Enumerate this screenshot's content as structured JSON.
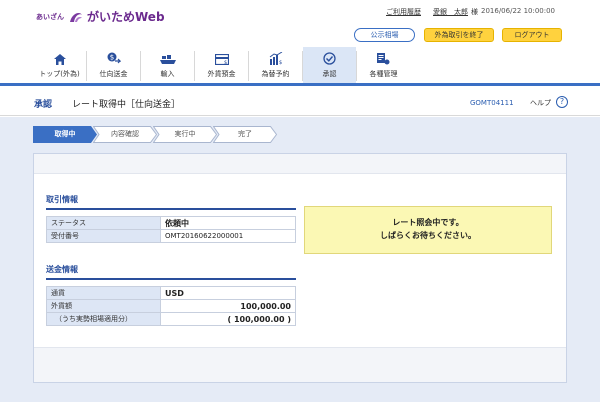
{
  "header": {
    "logo_sub": "あいざん",
    "logo_name": "がいためWeb",
    "history_link": "ご利用履歴",
    "user_name": "愛銀　太郎",
    "user_suffix": "様",
    "datetime": "2016/06/22 10:00:00",
    "public_rates_btn": "公示相場",
    "end_fx_btn": "外為取引を終了",
    "logout_btn": "ログアウト"
  },
  "nav": {
    "items": [
      {
        "label": "トップ(外為)",
        "icon": "home-icon"
      },
      {
        "label": "仕向送金",
        "icon": "remittance-icon"
      },
      {
        "label": "輸入",
        "icon": "import-icon"
      },
      {
        "label": "外貨預金",
        "icon": "deposit-icon"
      },
      {
        "label": "為替予約",
        "icon": "forward-contract-icon"
      },
      {
        "label": "承認",
        "icon": "approval-icon"
      },
      {
        "label": "各種管理",
        "icon": "management-icon"
      }
    ],
    "active": "承認"
  },
  "title": {
    "main": "承認",
    "sub": "レート取得中［仕向送金］",
    "screen_code": "GOMT04111",
    "help": "ヘルプ"
  },
  "steps": [
    "取得中",
    "内容確認",
    "実行中",
    "完了"
  ],
  "trade_info": {
    "heading": "取引情報",
    "rows": [
      {
        "label": "ステータス",
        "value": "依頼中"
      },
      {
        "label": "受付番号",
        "value": "OMT20160622000001"
      }
    ]
  },
  "remit_info": {
    "heading": "送金情報",
    "rows": [
      {
        "label": "通貨",
        "value": "USD"
      },
      {
        "label": "外貨額",
        "value": "100,000.00"
      },
      {
        "label": "（うち実勢相場適用分）",
        "value": "( 100,000.00 )"
      }
    ]
  },
  "notice": {
    "line1": "レート照会中です。",
    "line2": "しばらくお待ちください。"
  },
  "colors": {
    "accent": "#2a4f9c",
    "step_active": "#3a6fc4",
    "notice_bg": "#fbf8b4",
    "button_yellow": "#ffd23e"
  }
}
